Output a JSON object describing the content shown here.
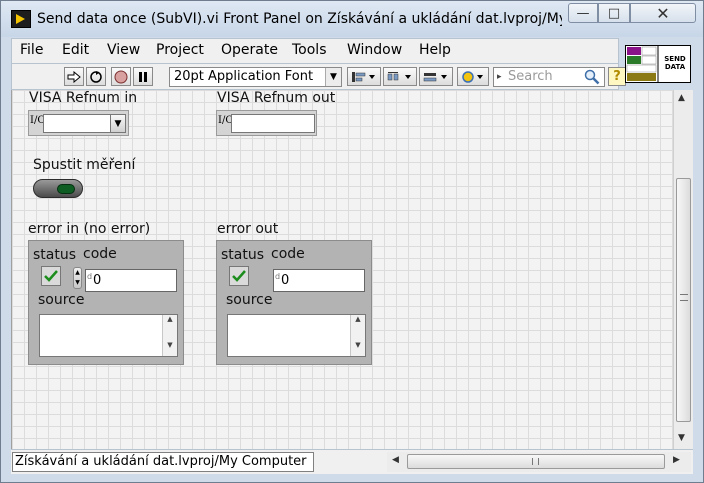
{
  "window": {
    "title": "Send data once (SubVI).vi Front Panel on Získávání a ukládání dat.lvproj/My Co...",
    "icon_name": "labview-vi-icon"
  },
  "menu": {
    "items": [
      "File",
      "Edit",
      "View",
      "Project",
      "Operate",
      "Tools",
      "Window",
      "Help"
    ]
  },
  "toolbar": {
    "font_selector": "20pt Application Font",
    "search_placeholder": "Search"
  },
  "vi_icon": {
    "line1": "SEND",
    "line2": "DATA"
  },
  "panel": {
    "visa_in_label": "VISA Refnum in",
    "visa_out_label": "VISA Refnum out",
    "visa_glyph": "I/O",
    "bool_label": "Spustit měření",
    "error_in": {
      "label": "error in (no error)",
      "status_label": "status",
      "code_label": "code",
      "code_value": "0",
      "source_label": "source"
    },
    "error_out": {
      "label": "error out",
      "status_label": "status",
      "code_label": "code",
      "code_value": "0",
      "source_label": "source"
    }
  },
  "statusbar": {
    "project_path": "Získávání a ukládání dat.lvproj/My Computer"
  },
  "colors": {
    "titlebar": "#c7d6e8",
    "panel_grid": "#dcdcdc",
    "cluster_bg": "#b3b3b3",
    "led_green": "#0d5d22"
  }
}
